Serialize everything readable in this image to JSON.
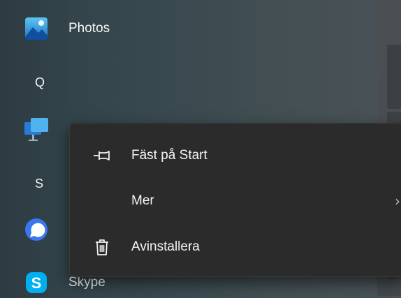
{
  "start_menu": {
    "apps": [
      {
        "name": "Photos",
        "icon": "photos-icon"
      },
      {
        "name": "Remote Desktop",
        "icon": "remote-desktop-icon"
      },
      {
        "name": "Signal",
        "icon": "signal-icon"
      },
      {
        "name": "Skype",
        "icon": "skype-icon"
      }
    ],
    "letter_headers": [
      "Q",
      "S"
    ]
  },
  "context_menu": {
    "items": [
      {
        "label": "Fäst på Start",
        "icon": "pin-icon"
      },
      {
        "label": "Mer",
        "icon": "",
        "has_submenu": true
      },
      {
        "label": "Avinstallera",
        "icon": "trash-icon"
      }
    ]
  },
  "colors": {
    "menu_background": "#2b2b2b",
    "skype_blue": "#00aff0",
    "signal_blue": "#3a76f0",
    "photos_blue": "#2f8fd8"
  }
}
